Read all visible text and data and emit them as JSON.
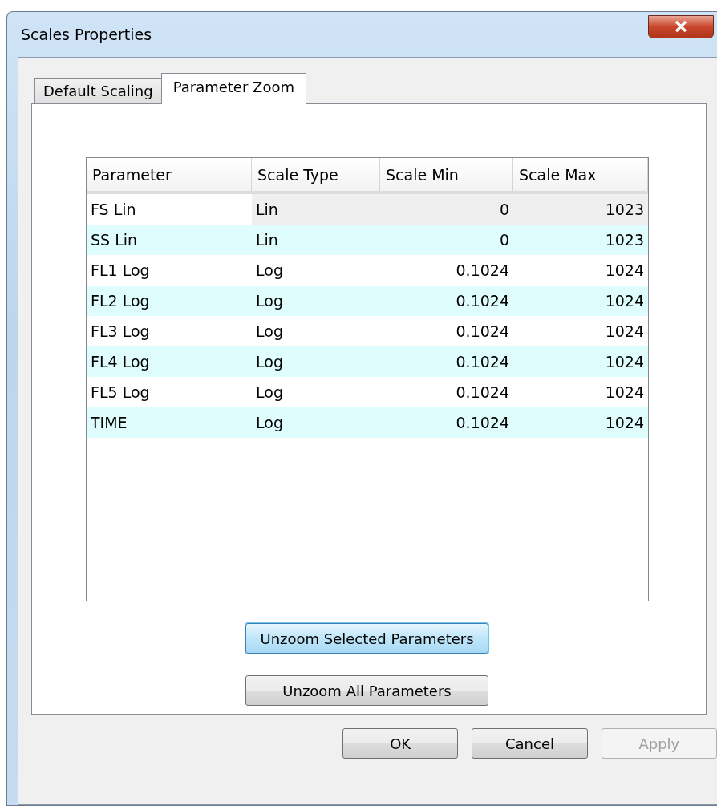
{
  "window": {
    "title": "Scales Properties"
  },
  "tabs": [
    {
      "label": "Default Scaling",
      "selected": false
    },
    {
      "label": "Parameter Zoom",
      "selected": true
    }
  ],
  "table": {
    "columns": [
      "Parameter",
      "Scale Type",
      "Scale Min",
      "Scale Max"
    ],
    "rows": [
      {
        "cells": [
          "FS Lin",
          "Lin",
          "0",
          "1023"
        ],
        "selected": true
      },
      {
        "cells": [
          "SS Lin",
          "Lin",
          "0",
          "1023"
        ],
        "selected": false
      },
      {
        "cells": [
          "FL1 Log",
          "Log",
          "0.1024",
          "1024"
        ],
        "selected": false
      },
      {
        "cells": [
          "FL2 Log",
          "Log",
          "0.1024",
          "1024"
        ],
        "selected": false
      },
      {
        "cells": [
          "FL3 Log",
          "Log",
          "0.1024",
          "1024"
        ],
        "selected": false
      },
      {
        "cells": [
          "FL4 Log",
          "Log",
          "0.1024",
          "1024"
        ],
        "selected": false
      },
      {
        "cells": [
          "FL5 Log",
          "Log",
          "0.1024",
          "1024"
        ],
        "selected": false
      },
      {
        "cells": [
          "TIME",
          "Log",
          "0.1024",
          "1024"
        ],
        "selected": false
      }
    ]
  },
  "panel_buttons": [
    {
      "label": "Unzoom Selected Parameters",
      "focused": true
    },
    {
      "label": "Unzoom All Parameters",
      "focused": false
    }
  ],
  "dialog_buttons": [
    {
      "label": "OK",
      "disabled": false
    },
    {
      "label": "Cancel",
      "disabled": false
    },
    {
      "label": "Apply",
      "disabled": true
    }
  ]
}
